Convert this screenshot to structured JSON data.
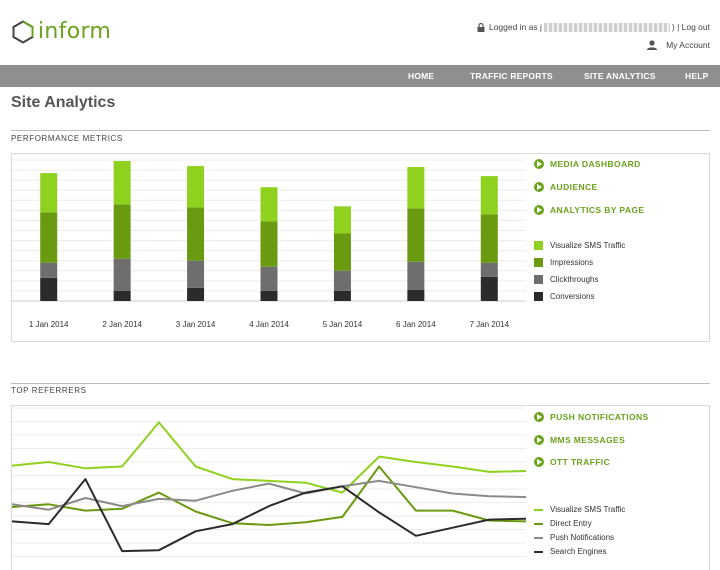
{
  "brand": {
    "name": "inform",
    "color": "#6aa31e"
  },
  "account": {
    "logged_in_prefix": "Logged in as j",
    "logged_in_suffix": ") | Log out",
    "my_account": "My Account"
  },
  "nav": {
    "items": [
      "HOME",
      "TRAFFIC REPORTS",
      "SITE ANALYTICS",
      "HELP"
    ]
  },
  "page": {
    "title": "Site Analytics"
  },
  "performance": {
    "section_title": "PERFORMANCE METRICS",
    "links": [
      "MEDIA DASHBOARD",
      "AUDIENCE",
      "ANALYTICS BY PAGE"
    ],
    "legend": [
      {
        "label": "Visualize SMS Traffic",
        "color": "#8fd11f"
      },
      {
        "label": "Impressions",
        "color": "#6a9a10"
      },
      {
        "label": "Clickthroughs",
        "color": "#6e6e6e"
      },
      {
        "label": "Conversions",
        "color": "#2b2b2b"
      }
    ]
  },
  "referrers": {
    "section_title": "TOP REFERRERS",
    "links": [
      "PUSH NOTIFICATIONS",
      "MMS MESSAGES",
      "OTT TRAFFIC"
    ],
    "legend": [
      {
        "label": "Visualize SMS Traffic",
        "color": "#8fd11f"
      },
      {
        "label": "Direct Entry",
        "color": "#6a9a10"
      },
      {
        "label": "Push Notifications",
        "color": "#8a8a8a"
      },
      {
        "label": "Search Engines",
        "color": "#2b2b2b"
      }
    ]
  },
  "chart_data": [
    {
      "type": "bar",
      "stacked": true,
      "categories": [
        "1 Jan 2014",
        "2 Jan 2014",
        "3 Jan 2014",
        "4 Jan 2014",
        "5 Jan 2014",
        "6 Jan 2014",
        "7 Jan 2014"
      ],
      "series": [
        {
          "name": "Conversions",
          "color": "#2b2b2b",
          "values": [
            23,
            10,
            13,
            10,
            10,
            11,
            24
          ]
        },
        {
          "name": "Clickthroughs",
          "color": "#6e6e6e",
          "values": [
            15,
            32,
            27,
            24,
            20,
            28,
            14
          ]
        },
        {
          "name": "Impressions",
          "color": "#6a9a10",
          "values": [
            50,
            54,
            53,
            45,
            37,
            53,
            48
          ]
        },
        {
          "name": "Visualize SMS Traffic",
          "color": "#8fd11f",
          "values": [
            39,
            43,
            41,
            34,
            27,
            41,
            38
          ]
        }
      ],
      "ylim": [
        0,
        140
      ],
      "grid": true
    },
    {
      "type": "line",
      "series": [
        {
          "name": "Visualize SMS Traffic",
          "color": "#8fd11f",
          "values": [
            116,
            120,
            113,
            115,
            164,
            115,
            101,
            99,
            97,
            86,
            126,
            120,
            115,
            109,
            110
          ]
        },
        {
          "name": "Direct Entry",
          "color": "#6a9a10",
          "values": [
            70,
            73,
            66,
            68,
            86,
            65,
            52,
            50,
            53,
            59,
            115,
            66,
            66,
            55,
            54
          ]
        },
        {
          "name": "Push Notifications",
          "color": "#8a8a8a",
          "values": [
            73,
            67,
            80,
            71,
            79,
            77,
            88,
            96,
            85,
            93,
            99,
            92,
            85,
            82,
            81
          ]
        },
        {
          "name": "Search Engines",
          "color": "#2b2b2b",
          "values": [
            54,
            51,
            101,
            21,
            22,
            43,
            51,
            71,
            86,
            93,
            64,
            38,
            47,
            56,
            57
          ]
        }
      ],
      "ylim": [
        0,
        180
      ],
      "grid": true
    }
  ]
}
